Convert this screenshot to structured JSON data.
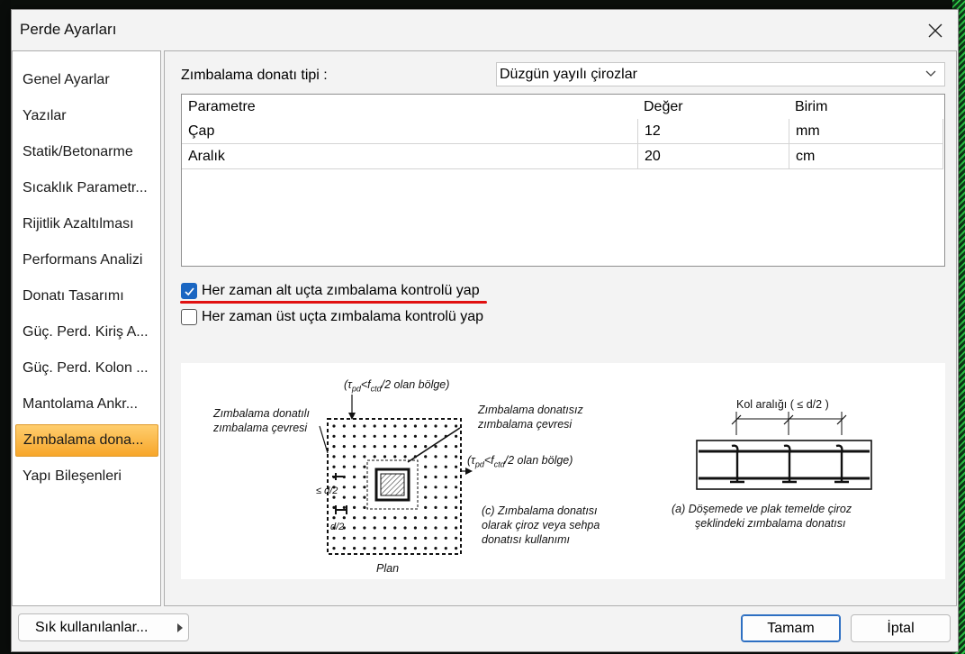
{
  "dialog": {
    "title": "Perde Ayarları"
  },
  "nav": {
    "items": [
      {
        "label": "Genel Ayarlar",
        "selected": false
      },
      {
        "label": "Yazılar",
        "selected": false
      },
      {
        "label": "Statik/Betonarme",
        "selected": false
      },
      {
        "label": "Sıcaklık Parametr...",
        "selected": false
      },
      {
        "label": "Rijitlik Azaltılması",
        "selected": false
      },
      {
        "label": "Performans Analizi",
        "selected": false
      },
      {
        "label": "Donatı Tasarımı",
        "selected": false
      },
      {
        "label": "Güç. Perd. Kiriş A...",
        "selected": false
      },
      {
        "label": "Güç. Perd. Kolon ...",
        "selected": false
      },
      {
        "label": "Mantolama Ankr...",
        "selected": false
      },
      {
        "label": "Zımbalama dona...",
        "selected": true
      },
      {
        "label": "Yapı Bileşenleri",
        "selected": false
      }
    ]
  },
  "content": {
    "type_label": "Zımbalama donatı tipi :",
    "type_value": "Düzgün yayılı çirozlar",
    "table": {
      "headers": [
        "Parametre",
        "Değer",
        "Birim"
      ],
      "rows": [
        [
          "Çap",
          "12",
          "mm"
        ],
        [
          "Aralık",
          "20",
          "cm"
        ]
      ]
    },
    "checkboxes": [
      {
        "label": "Her zaman alt uçta zımbalama kontrolü yap",
        "checked": true
      },
      {
        "label": "Her zaman üst uçta zımbalama kontrolü yap",
        "checked": false
      }
    ],
    "figure": {
      "top_label_a": "(τ",
      "top_label_sub1": "pd",
      "top_label_mid": "<f",
      "top_label_sub2": "ctd",
      "top_label_end": "/2 olan bölge)",
      "left_label_1": "Zımbalama donatılı",
      "left_label_2": "zımbalama çevresi",
      "right_label_1": "Zımbalama donatısız",
      "right_label_2": "zımbalama çevresi",
      "side_label_end": "/2 olan bölge)",
      "dim_a": "≤ d/2",
      "dim_b": "d/2",
      "caption_c_1": "(c) Zımbalama donatısı",
      "caption_c_2": "olarak çiroz veya sehpa",
      "caption_c_3": "donatısı kullanımı",
      "plan_label": "Plan",
      "kol_label": "Kol aralığı ( ≤ d/2 )",
      "caption_a_1": "(a) Döşemede ve plak temelde çiroz",
      "caption_a_2": "şeklindeki zımbalama donatısı"
    }
  },
  "footer": {
    "favorites": "Sık kullanılanlar...",
    "ok": "Tamam",
    "cancel": "İptal"
  },
  "colors": {
    "accent": "#1a66c2",
    "selected_nav": "#f7a62a",
    "underline": "#e01010"
  }
}
